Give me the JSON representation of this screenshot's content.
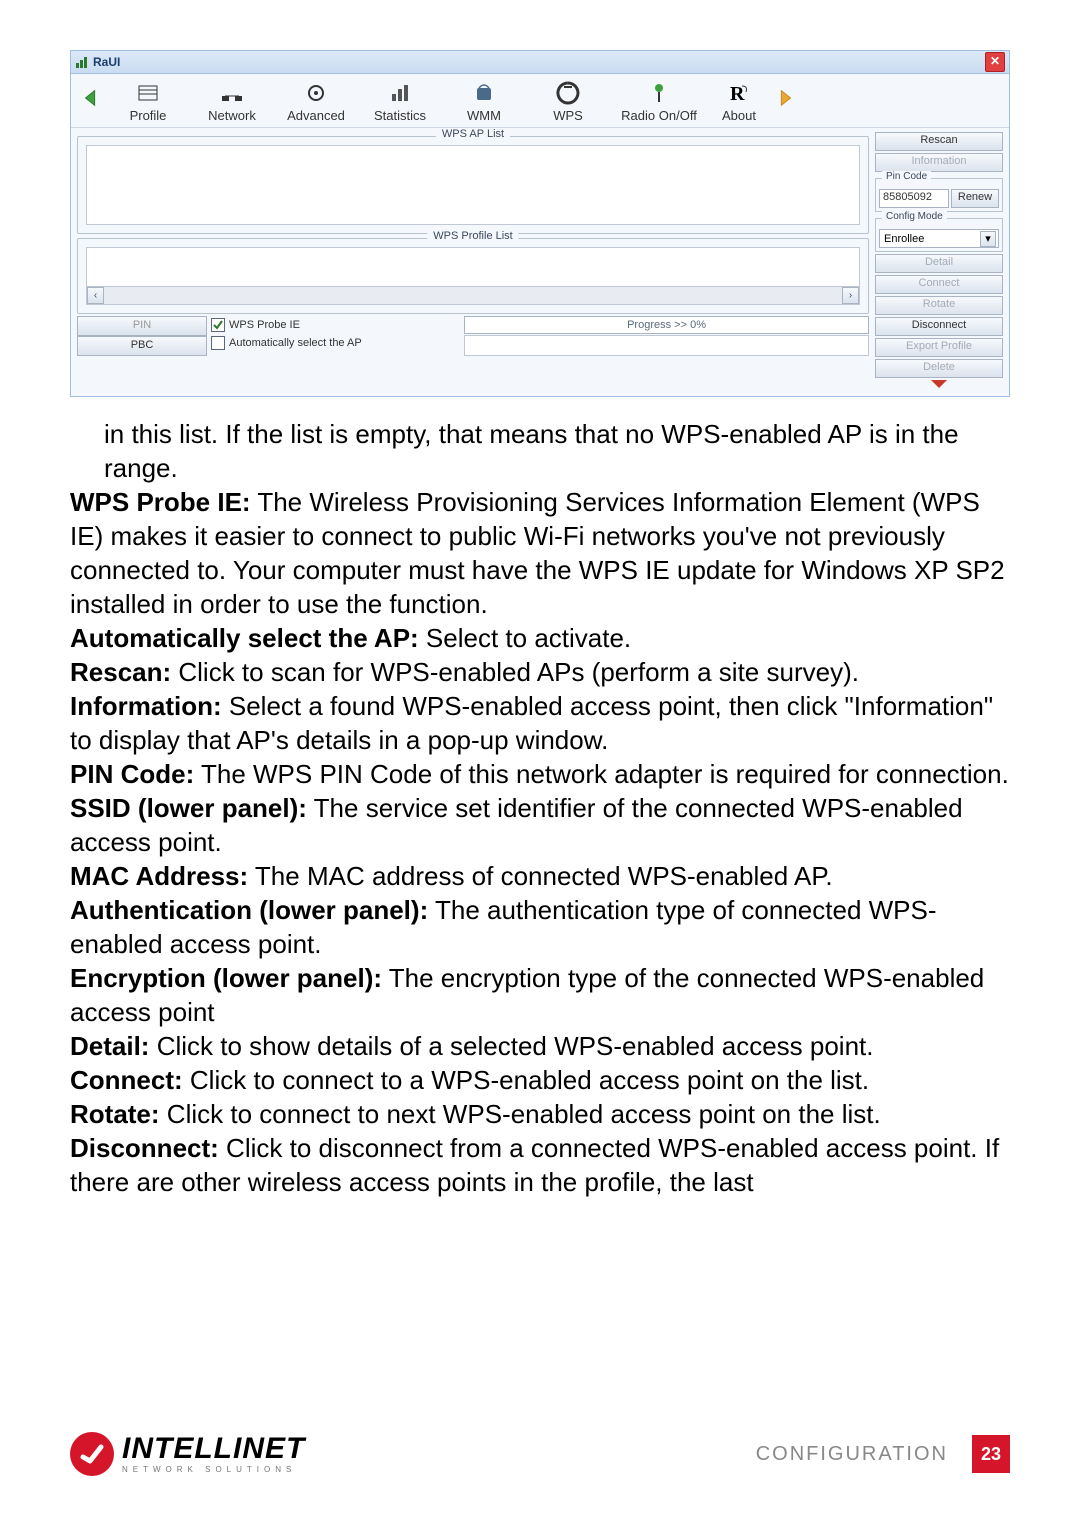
{
  "app": {
    "title": "RaUI",
    "toolbar": {
      "profile": "Profile",
      "network": "Network",
      "advanced": "Advanced",
      "statistics": "Statistics",
      "wmm": "WMM",
      "wps": "WPS",
      "radio": "Radio On/Off",
      "about": "About"
    },
    "wps_ap_list_label": "WPS AP List",
    "wps_profile_list_label": "WPS Profile List",
    "pin_label": "PIN",
    "pbc_label": "PBC",
    "wps_probe_ie_label": "WPS Probe IE",
    "auto_select_label": "Automatically select the AP",
    "progress_text": "Progress >> 0%",
    "side": {
      "rescan": "Rescan",
      "information": "Information",
      "pin_code_label": "Pin Code",
      "pin_value": "85805092",
      "renew": "Renew",
      "config_mode_label": "Config Mode",
      "config_mode_value": "Enrollee",
      "detail": "Detail",
      "connect": "Connect",
      "rotate": "Rotate",
      "disconnect": "Disconnect",
      "export_profile": "Export Profile",
      "delete": "Delete"
    }
  },
  "doc": {
    "p1a": "in this list. If the list is empty, that means that no WPS-enabled AP is in the range.",
    "p2b": "WPS Probe IE:",
    "p2t": " The Wireless Provisioning Services Information Element (WPS IE) makes it easier to connect to public Wi-Fi networks you've not previously connected to. Your computer must have the WPS IE update for Windows XP SP2 installed in order to use the function.",
    "p3b": "Automatically select the AP:",
    "p3t": " Select to activate.",
    "p4b": "Rescan:",
    "p4t": " Click to scan for WPS-enabled APs (perform a site survey).",
    "p5b": "Information:",
    "p5t": " Select a found WPS-enabled access point, then click \"Information\" to display that AP's details in a pop-up window.",
    "p6b": "PIN Code:",
    "p6t": " The WPS PIN Code of this network adapter is required for connection.",
    "p7b": "SSID (lower panel):",
    "p7t": " The service set identifier of the connected WPS-enabled access point.",
    "p8b": "MAC Address:",
    "p8t": " The MAC address of connected WPS-enabled AP.",
    "p9b": "Authentication (lower panel):",
    "p9t": " The authentication type of connected WPS-enabled access point.",
    "p10b": "Encryption (lower panel):",
    "p10t": " The encryption type of the connected WPS-enabled access point",
    "p11b": "Detail:",
    "p11t": " Click to show details of a selected WPS-enabled access point.",
    "p12b": "Connect:",
    "p12t": " Click to connect to a WPS-enabled access point on the list.",
    "p13b": "Rotate:",
    "p13t": " Click to connect to next WPS-enabled access point on the list.",
    "p14b": "Disconnect:",
    "p14t": " Click to disconnect from a connected WPS-enabled access point. If there are other wireless access points in the profile, the last"
  },
  "footer": {
    "brand_big": "INTELLINET",
    "brand_small": "NETWORK SOLUTIONS",
    "section": "CONFIGURATION",
    "page": "23"
  }
}
